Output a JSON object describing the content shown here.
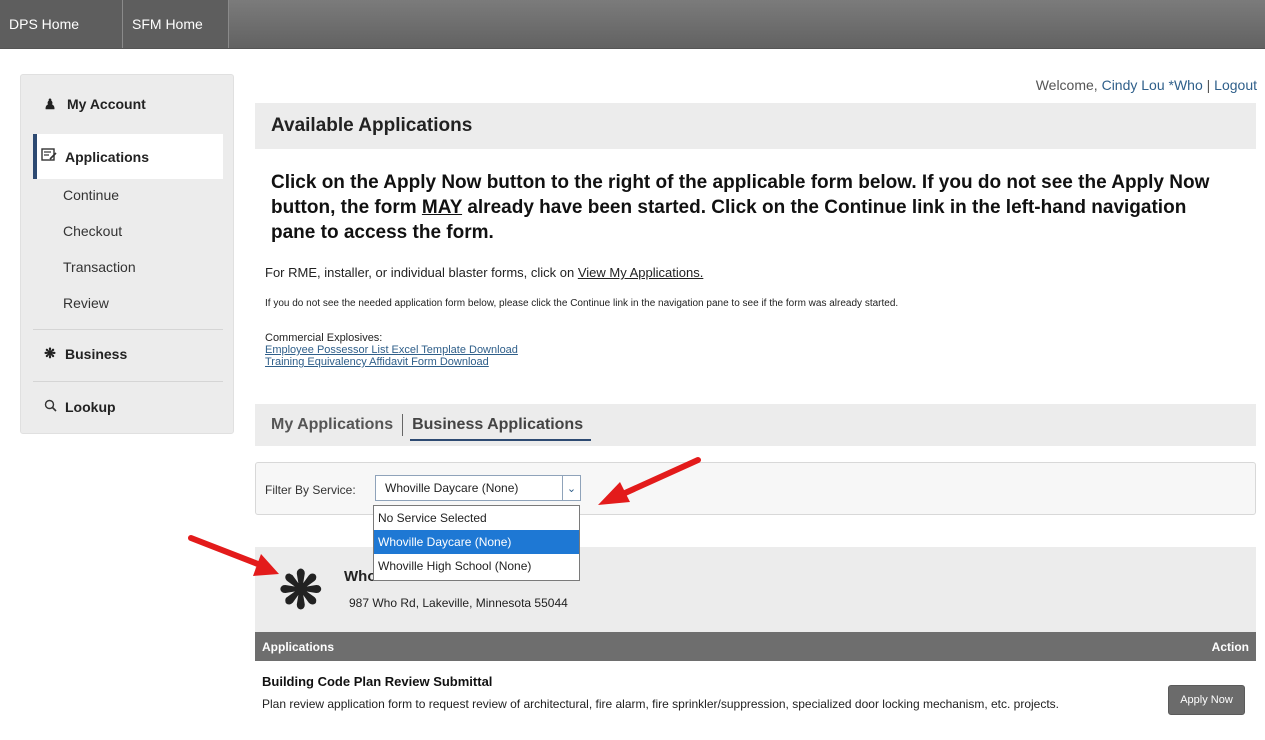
{
  "topnav": {
    "items": [
      "DPS Home",
      "SFM Home"
    ]
  },
  "sidebar": {
    "my_account": "My Account",
    "applications": "Applications",
    "sub_items": [
      "Continue",
      "Checkout",
      "Transaction",
      "Review"
    ],
    "business": "Business",
    "lookup": "Lookup"
  },
  "welcome": {
    "prefix": "Welcome, ",
    "user": "Cindy Lou *Who",
    "sep": " | ",
    "logout": "Logout"
  },
  "main": {
    "title": "Available Applications",
    "instructions_part1": "Click on the Apply Now button to the right of the applicable form below.  If you do not see the Apply Now button, the form ",
    "instructions_may": "MAY",
    "instructions_part2": " already have been started.  Click on the Continue link in the left-hand navigation pane to access the form.",
    "rme_text": "For RME, installer, or individual blaster forms, click on ",
    "rme_link": "View My Applications.",
    "notice": "If you do not see the needed application form below, please click the Continue link in the navigation pane to see if the form was already started.",
    "commercial_label": "Commercial Explosives:",
    "commercial_links": [
      "Employee Possessor List Excel Template Download",
      "Training Equivalency Affidavit Form Download"
    ]
  },
  "tabs": {
    "my_apps": "My Applications",
    "business_apps": "Business Applications"
  },
  "filter": {
    "label": "Filter By Service:",
    "selected": "Whoville Daycare (None)",
    "options": [
      "No Service Selected",
      "Whoville Daycare (None)",
      "Whoville High School (None)"
    ]
  },
  "business": {
    "name": "Who",
    "address": "987 Who Rd, Lakeville, Minnesota 55044"
  },
  "applications": {
    "col_applications": "Applications",
    "col_action": "Action",
    "rows": [
      {
        "title": "Building Code Plan Review Submittal",
        "description": "Plan review application form to request review of architectural, fire alarm, fire sprinkler/suppression, specialized door locking mechanism, etc. projects.",
        "action": "Apply Now"
      }
    ]
  },
  "colors": {
    "accent": "#2d4a72",
    "link": "#2f5f8a",
    "arrow": "#e31b1b"
  },
  "icons": {
    "my_account": "person-icon",
    "applications": "edit-document-icon",
    "business": "asterisk-icon",
    "lookup": "search-icon",
    "dropdown": "chevron-down-icon"
  }
}
